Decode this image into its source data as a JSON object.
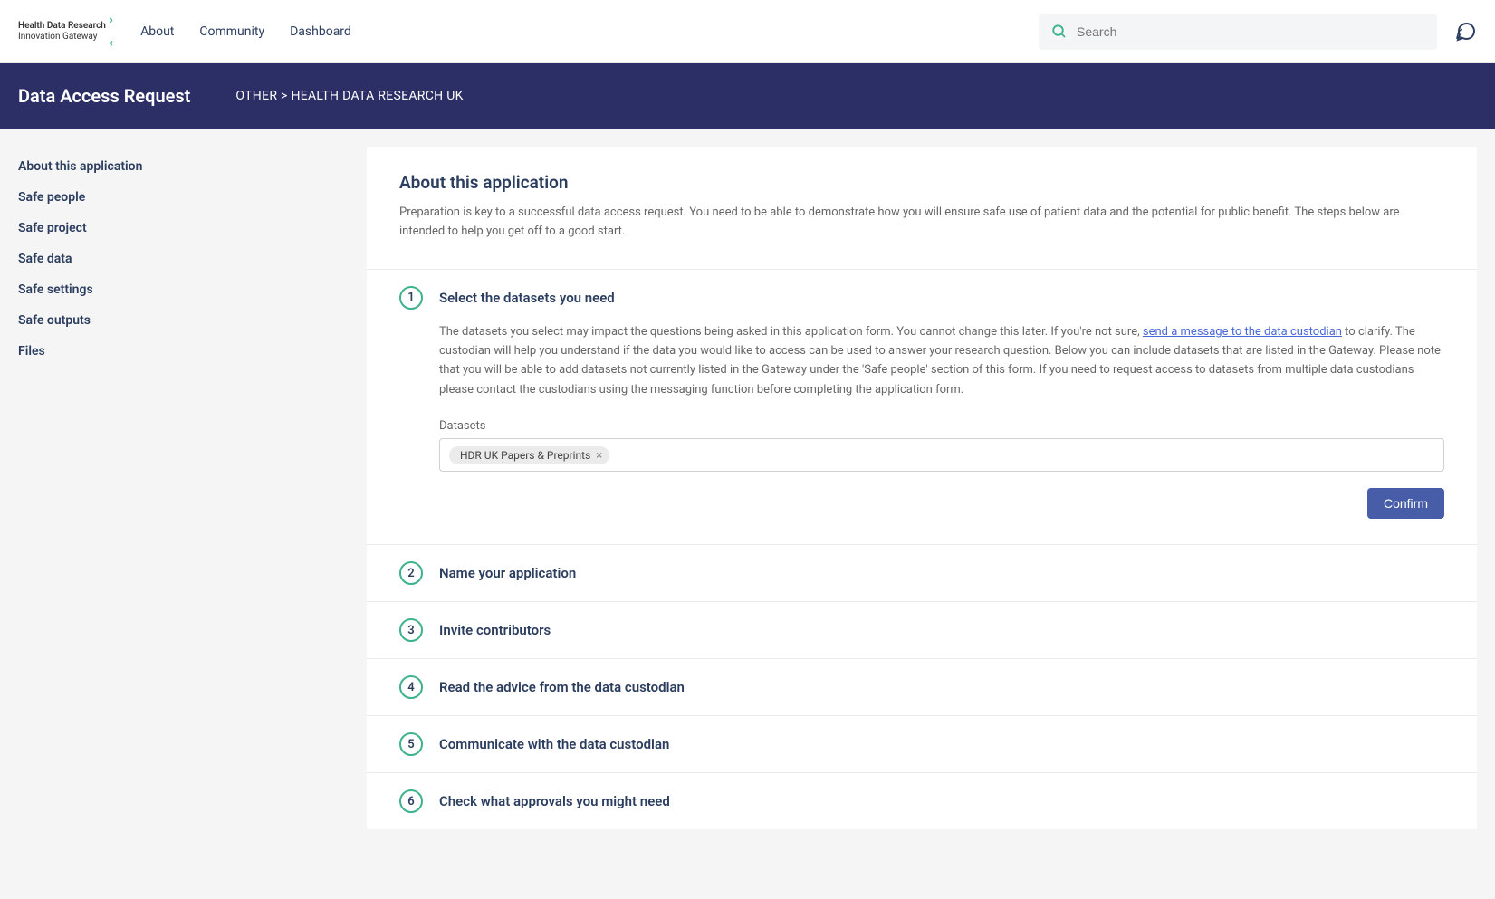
{
  "logo": {
    "line1": "Health Data Research",
    "line2": "Innovation Gateway"
  },
  "nav": {
    "about": "About",
    "community": "Community",
    "dashboard": "Dashboard"
  },
  "search": {
    "placeholder": "Search"
  },
  "header": {
    "title": "Data Access Request",
    "breadcrumb": "OTHER > HEALTH DATA RESEARCH UK"
  },
  "sidebar": {
    "items": [
      "About this application",
      "Safe people",
      "Safe project",
      "Safe data",
      "Safe settings",
      "Safe outputs",
      "Files"
    ]
  },
  "intro": {
    "title": "About this application",
    "text": "Preparation is key to a successful data access request. You need to be able to demonstrate how you will ensure safe use of patient data and the potential for public benefit. The steps below are intended to help you get off to a good start."
  },
  "step1": {
    "number": "1",
    "title": "Select the datasets you need",
    "desc_part1": "The datasets you select may impact the questions being asked in this application form. You cannot change this later. If you're not sure, ",
    "link": "send a message to the data custodian",
    "desc_part2": " to clarify. The custodian will help you understand if the data you would like to access can be used to answer your research question. Below you can include datasets that are listed in the Gateway. Please note that you will be able to add datasets not currently listed in the Gateway under the 'Safe people' section of this form. If you need to request access to datasets from multiple data custodians please contact the custodians using the messaging function before completing the application form.",
    "datasets_label": "Datasets",
    "tag": "HDR UK Papers & Preprints",
    "confirm": "Confirm"
  },
  "steps": [
    {
      "number": "2",
      "title": "Name your application"
    },
    {
      "number": "3",
      "title": "Invite contributors"
    },
    {
      "number": "4",
      "title": "Read the advice from the data custodian"
    },
    {
      "number": "5",
      "title": "Communicate with the data custodian"
    },
    {
      "number": "6",
      "title": "Check what approvals you might need"
    }
  ]
}
